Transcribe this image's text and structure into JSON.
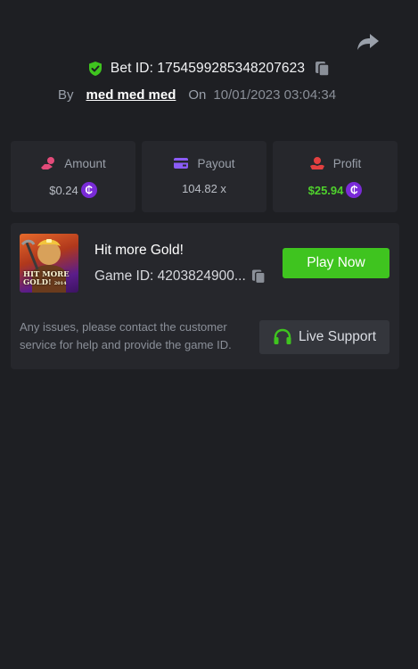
{
  "header": {
    "bet_label": "Bet ID: 1754599285348207623",
    "by_label": "By",
    "username": "med med med",
    "on_label": "On",
    "datetime": "10/01/2023 03:04:34"
  },
  "stats": {
    "amount": {
      "label": "Amount",
      "value": "$0.24",
      "icon": "hand-coin-icon"
    },
    "payout": {
      "label": "Payout",
      "value": "104.82 x",
      "icon": "wallet-icon"
    },
    "profit": {
      "label": "Profit",
      "value": "$25.94",
      "icon": "hand-money-icon"
    },
    "currency_symbol": "₵"
  },
  "game": {
    "title": "Hit more Gold!",
    "id_text": "Game ID: 4203824900...",
    "play_label": "Play Now",
    "thumb_text_line1": "HIT MORE",
    "thumb_text_line2": "GOLD!",
    "thumb_text_small": "2014"
  },
  "support": {
    "notice": "Any issues, please contact the customer service for help and provide the game ID.",
    "button_label": "Live Support"
  },
  "colors": {
    "background": "#1e1f23",
    "panel": "#26272c",
    "accent_green": "#3fc41f",
    "profit_green": "#4fd12c",
    "coin_purple": "#7a2bd8",
    "amount_icon": "#e34b7a",
    "payout_icon": "#8b5cf6",
    "profit_icon": "#e34040"
  }
}
